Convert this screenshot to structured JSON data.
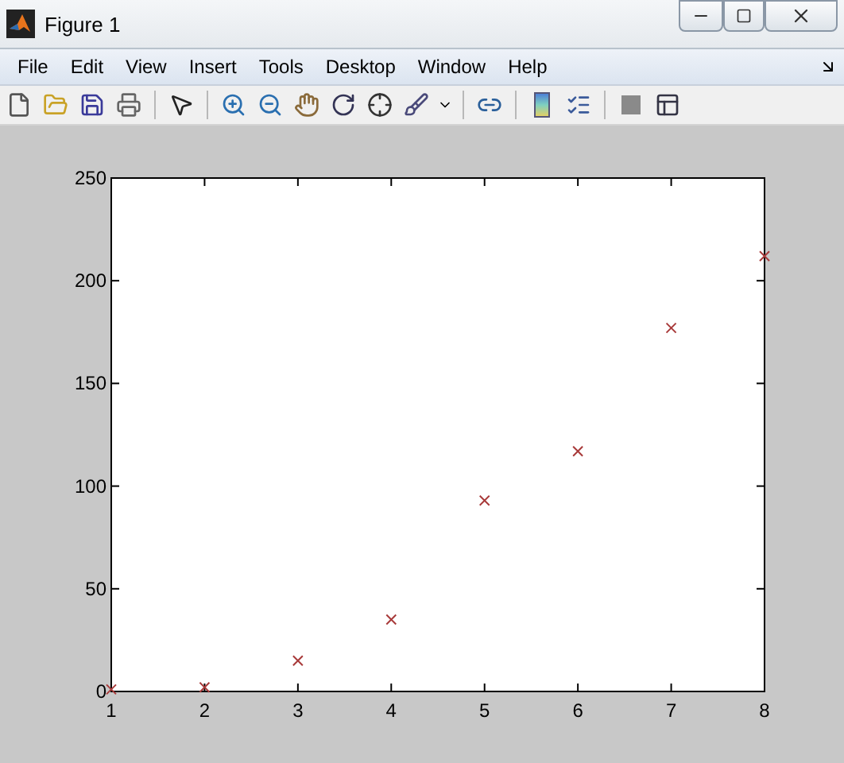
{
  "window": {
    "title": "Figure 1"
  },
  "menu": [
    "File",
    "Edit",
    "View",
    "Insert",
    "Tools",
    "Desktop",
    "Window",
    "Help"
  ],
  "chart_data": {
    "type": "scatter",
    "xlim": [
      1,
      8
    ],
    "ylim": [
      0,
      250
    ],
    "xticks": [
      1,
      2,
      3,
      4,
      5,
      6,
      7,
      8
    ],
    "yticks": [
      0,
      50,
      100,
      150,
      200,
      250
    ],
    "x": [
      1,
      2,
      3,
      4,
      5,
      6,
      7,
      8
    ],
    "series": [
      {
        "color": "#a83a3a",
        "values": [
          1,
          2,
          15,
          35,
          93,
          117,
          177,
          212
        ]
      }
    ]
  }
}
